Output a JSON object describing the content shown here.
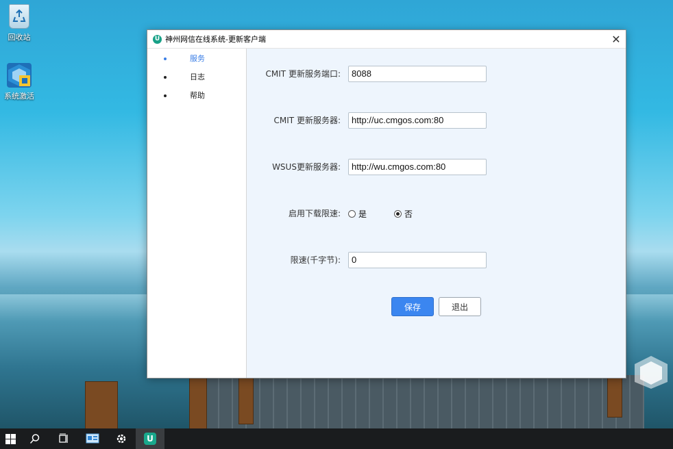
{
  "desktop": {
    "icons": [
      {
        "label": "回收站",
        "icon": "recycle-bin-icon"
      },
      {
        "label": "系统激活",
        "icon": "system-activation-icon"
      }
    ]
  },
  "window": {
    "title": "神州网信在线系统-更新客户端",
    "close_symbol": "✕",
    "logo_letter": "U"
  },
  "sidebar": {
    "items": [
      {
        "label": "服务",
        "active": true
      },
      {
        "label": "日志",
        "active": false
      },
      {
        "label": "帮助",
        "active": false
      }
    ]
  },
  "form": {
    "cmit_port": {
      "label": "CMIT 更新服务端口:",
      "value": "8088"
    },
    "cmit_server": {
      "label": "CMIT 更新服务器:",
      "value": "http://uc.cmgos.com:80"
    },
    "wsus_server": {
      "label": "WSUS更新服务器:",
      "value": "http://wu.cmgos.com:80"
    },
    "rate_limit_enable": {
      "label": "启用下载限速:",
      "options": [
        {
          "label": "是",
          "checked": false
        },
        {
          "label": "否",
          "checked": true
        }
      ]
    },
    "rate_limit": {
      "label": "限速(千字节):",
      "value": "0"
    },
    "save_label": "保存",
    "exit_label": "退出"
  },
  "taskbar": {
    "items": [
      "start-icon",
      "search-icon",
      "task-view-icon",
      "pc-manager-icon",
      "settings-icon",
      "update-client-icon"
    ],
    "app_letter": "U"
  },
  "colors": {
    "accent": "#3b86f0",
    "active_nav": "#3a7ee6",
    "app_green": "#18a187"
  }
}
